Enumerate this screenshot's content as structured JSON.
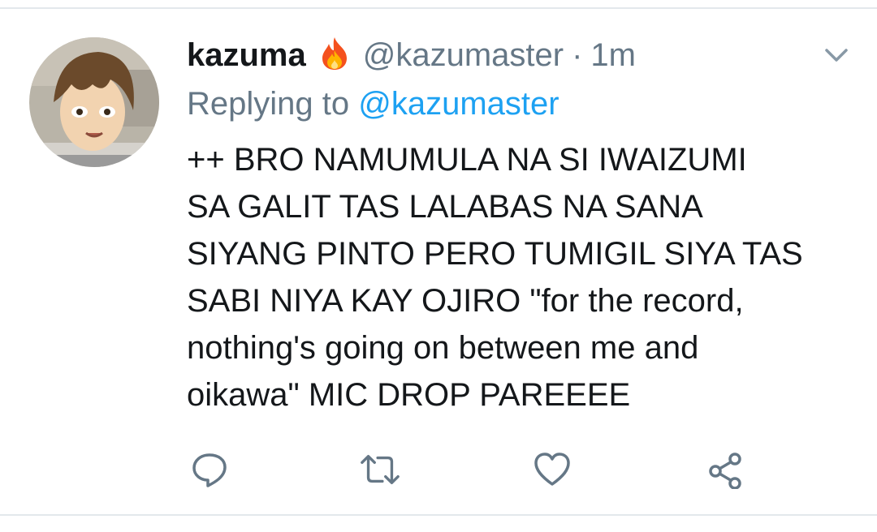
{
  "tweet": {
    "display_name": "kazuma",
    "name_emoji": "fire-icon",
    "handle": "@kazumaster",
    "separator": "·",
    "time": "1m",
    "replying_prefix": "Replying to",
    "replying_handle": "@kazumaster",
    "text_lines": [
      "++ BRO NAMUMULA NA SI IWAIZUMI",
      "SA GALIT TAS LALABAS NA SANA",
      "SIYANG PINTO PERO TUMIGIL SIYA TAS",
      "SABI NIYA KAY OJIRO \"for the record,",
      "nothing's going on between me and",
      "oikawa\" MIC DROP PAREEEE"
    ]
  },
  "actions": [
    {
      "name": "reply-icon"
    },
    {
      "name": "retweet-icon"
    },
    {
      "name": "like-icon"
    },
    {
      "name": "share-icon"
    }
  ],
  "colors": {
    "text": "#14171a",
    "secondary": "#657786",
    "link": "#1da1f2",
    "divider": "#e3e8ec"
  }
}
